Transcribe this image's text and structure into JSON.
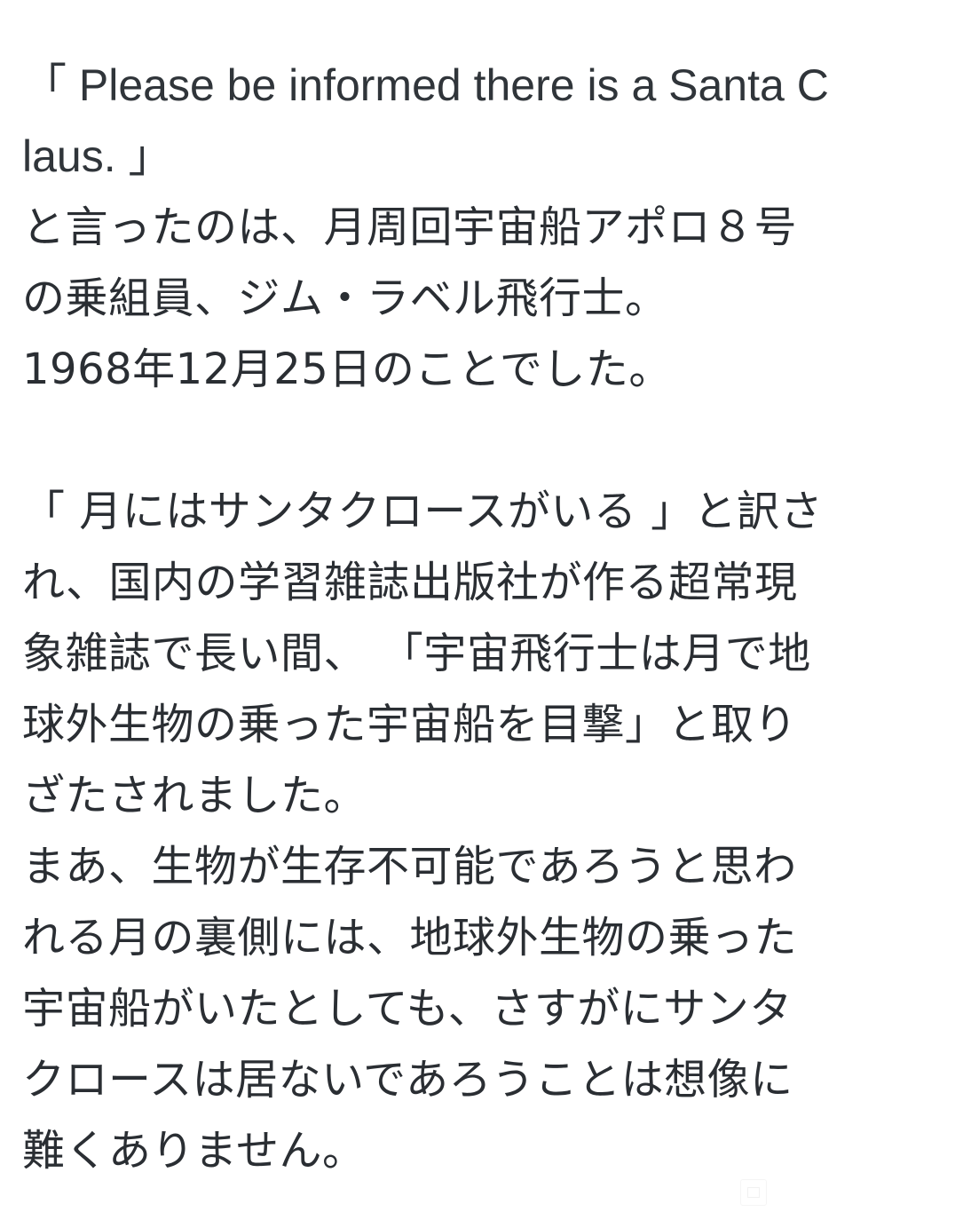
{
  "article": {
    "paragraph1": {
      "lines": [
        "「 Please be informed there is a Santa C",
        "laus. 」",
        "と言ったのは、月周回宇宙船アポロ８号",
        "の乗組員、ジム・ラベル飛行士。",
        "1968年12月25日のことでした。"
      ]
    },
    "paragraph2": {
      "lines": [
        "「 月にはサンタクロースがいる 」と訳さ",
        "れ、国内の学習雑誌出版社が作る超常現",
        "象雑誌で長い間、 「宇宙飛行士は月で地",
        "球外生物の乗った宇宙船を目撃」と取り",
        "ざたされました。",
        "まあ、生物が生存不可能であろうと思わ",
        "れる月の裏側には、地球外生物の乗った",
        "宇宙船がいたとしても、さすがにサンタ",
        "クロースは居ないであろうことは想像に",
        "難くありません。"
      ]
    }
  }
}
